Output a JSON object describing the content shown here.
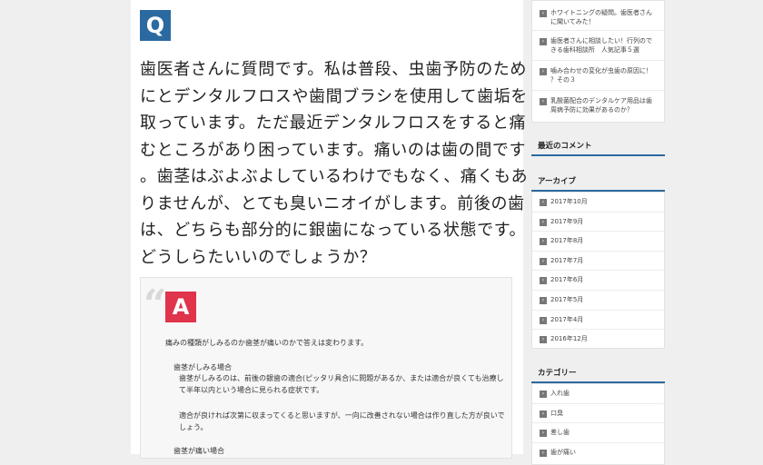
{
  "question": {
    "badge": "Q",
    "lines": [
      "歯医者さんに質問です。私は普段、虫歯予防のため",
      "にとデンタルフロスや歯間ブラシを使用して歯垢を",
      "取っています。ただ最近デンタルフロスをすると痛",
      "むところがあり困っています。痛いのは歯の間です",
      "。歯茎はぶよぶよしているわけでもなく、痛くもあ",
      "りませんが、とても臭いニオイがします。前後の歯",
      "は、どちらも部分的に銀歯になっている状態です。",
      "どうしらたいいのでしょうか？"
    ]
  },
  "answer": {
    "quote_mark": "“",
    "badge": "A",
    "intro": "痛みの種類がしみるのか歯茎が痛いのかで答えは変わります。",
    "case1_heading": "歯茎がしみる場合",
    "case1_line1": "歯茎がしみるのは、前後の銀歯の適合(ピッタリ具合)に問題があるか、または適合が良くても治療し",
    "case1_line2": "て半年以内という場合に見られる症状です。",
    "case1_line3": "適合が良ければ次第に収まってくると思いますが、一向に改善されない場合は作り直した方が良いで",
    "case1_line4": "しょう。",
    "case2_heading": "歯茎が痛い場合"
  },
  "sidebar": {
    "popular": [
      {
        "lines": [
          "ホワイトニングの疑問。歯医者さん",
          "に聞いてみた！"
        ]
      },
      {
        "lines": [
          "歯医者さんに相談したい！行列ので",
          "きる歯科相談所　人気記事５選"
        ]
      },
      {
        "lines": [
          "噛み合わせの変化が虫歯の原因に！",
          "？その３"
        ]
      },
      {
        "lines": [
          "乳酸菌配合のデンタルケア用品は歯",
          "周病予防に効果があるのか？"
        ]
      }
    ],
    "recent_comments_heading": "最近のコメント",
    "archive_heading": "アーカイブ",
    "archives": [
      "2017年10月",
      "2017年9月",
      "2017年8月",
      "2017年7月",
      "2017年6月",
      "2017年5月",
      "2017年4月",
      "2016年12月"
    ],
    "category_heading": "カテゴリー",
    "categories": [
      "入れ歯",
      "口臭",
      "差し歯",
      "歯が痛い"
    ]
  },
  "colors": {
    "q_badge": "#2a6aa0",
    "a_badge": "#e0334c",
    "heading_underline": "#2a6aa0"
  }
}
